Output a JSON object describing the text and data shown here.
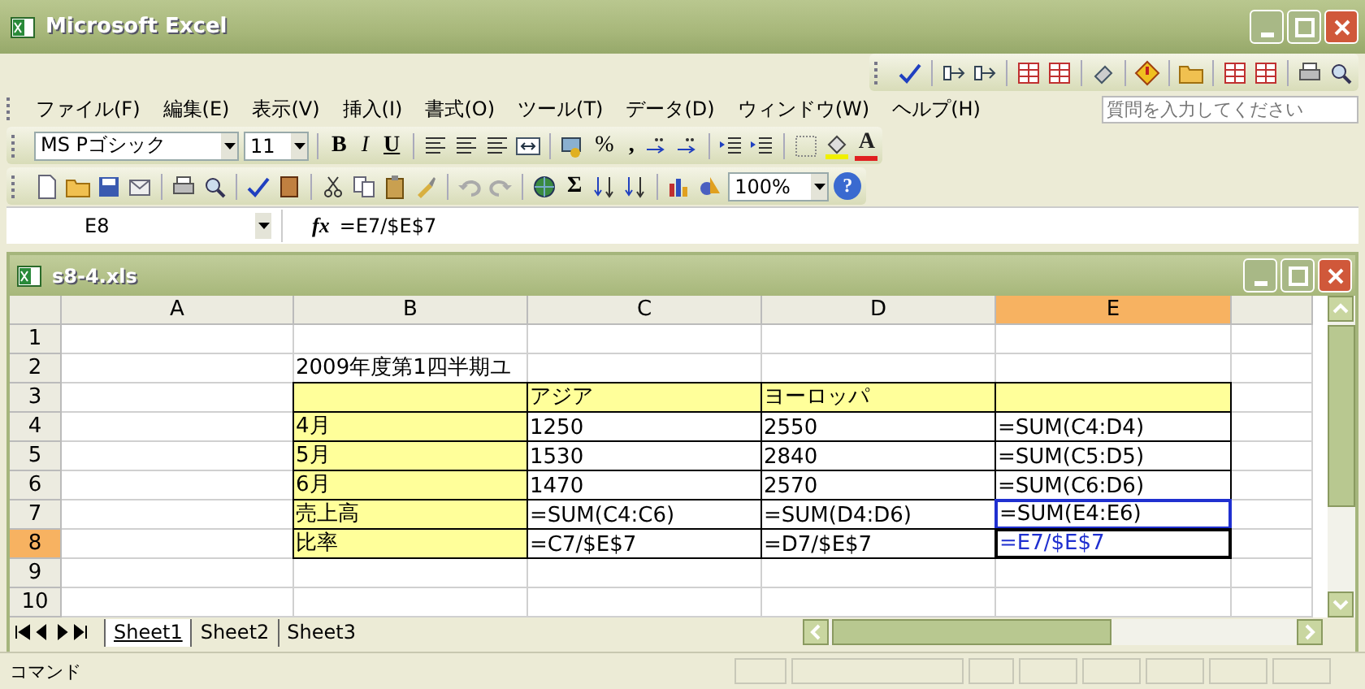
{
  "window": {
    "title": "Microsoft Excel"
  },
  "menu": [
    {
      "label": "ファイル(F)"
    },
    {
      "label": "編集(E)"
    },
    {
      "label": "表示(V)"
    },
    {
      "label": "挿入(I)"
    },
    {
      "label": "書式(O)"
    },
    {
      "label": "ツール(T)"
    },
    {
      "label": "データ(D)"
    },
    {
      "label": "ウィンドウ(W)"
    },
    {
      "label": "ヘルプ(H)"
    }
  ],
  "help_search": {
    "placeholder": "質問を入力してください"
  },
  "format_toolbar": {
    "font": "MS Pゴシック",
    "size": "11",
    "bold": "B",
    "italic": "I",
    "underline": "U",
    "percent": "%",
    "comma": ",",
    "font_color": "A"
  },
  "standard_toolbar": {
    "autosum": "Σ",
    "zoom": "100%",
    "help": "?"
  },
  "formula_bar": {
    "name_box": "E8",
    "function_label": "fx",
    "formula": "=E7/$E$7"
  },
  "workbook": {
    "title": "s8-4.xls",
    "columns": [
      {
        "label": "A",
        "selected": false
      },
      {
        "label": "B",
        "selected": false
      },
      {
        "label": "C",
        "selected": false
      },
      {
        "label": "D",
        "selected": false
      },
      {
        "label": "E",
        "selected": true
      }
    ],
    "rows": [
      {
        "number": "1",
        "selected": false,
        "cells": [
          {
            "kind": "plain"
          },
          {
            "kind": "plain"
          },
          {
            "kind": "plain"
          },
          {
            "kind": "plain"
          },
          {
            "kind": "plain"
          }
        ]
      },
      {
        "number": "2",
        "selected": false,
        "cells": [
          {
            "kind": "plain"
          },
          {
            "kind": "plain",
            "text": "2009年度第1四半期ユ"
          },
          {
            "kind": "plain"
          },
          {
            "kind": "plain"
          },
          {
            "kind": "plain"
          }
        ]
      },
      {
        "number": "3",
        "selected": false,
        "cells": [
          {
            "kind": "plain"
          },
          {
            "kind": "label"
          },
          {
            "kind": "label",
            "text": "アジア"
          },
          {
            "kind": "label",
            "text": "ヨーロッパ"
          },
          {
            "kind": "label"
          }
        ]
      },
      {
        "number": "4",
        "selected": false,
        "cells": [
          {
            "kind": "plain"
          },
          {
            "kind": "label",
            "text": "4月"
          },
          {
            "kind": "data",
            "text": "1250"
          },
          {
            "kind": "data",
            "text": "2550"
          },
          {
            "kind": "data",
            "text": "=SUM(C4:D4)"
          }
        ]
      },
      {
        "number": "5",
        "selected": false,
        "cells": [
          {
            "kind": "plain"
          },
          {
            "kind": "label",
            "text": "5月"
          },
          {
            "kind": "data",
            "text": "1530"
          },
          {
            "kind": "data",
            "text": "2840"
          },
          {
            "kind": "data",
            "text": "=SUM(C5:D5)"
          }
        ]
      },
      {
        "number": "6",
        "selected": false,
        "cells": [
          {
            "kind": "plain"
          },
          {
            "kind": "label",
            "text": "6月"
          },
          {
            "kind": "data",
            "text": "1470"
          },
          {
            "kind": "data",
            "text": "2570"
          },
          {
            "kind": "data",
            "text": "=SUM(C6:D6)"
          }
        ]
      },
      {
        "number": "7",
        "selected": false,
        "cells": [
          {
            "kind": "plain"
          },
          {
            "kind": "label",
            "text": "売上高"
          },
          {
            "kind": "data",
            "text": "=SUM(C4:C6)"
          },
          {
            "kind": "data",
            "text": "=SUM(D4:D6)"
          },
          {
            "kind": "reference",
            "text": "=SUM(E4:E6)"
          }
        ]
      },
      {
        "number": "8",
        "selected": true,
        "cells": [
          {
            "kind": "plain"
          },
          {
            "kind": "label",
            "text": "比率"
          },
          {
            "kind": "data",
            "text": "=C7/$E$7"
          },
          {
            "kind": "data",
            "text": "=D7/$E$7"
          },
          {
            "kind": "editing",
            "text": "=E7/$E$7"
          }
        ]
      },
      {
        "number": "9",
        "selected": false,
        "cells": [
          {
            "kind": "plain"
          },
          {
            "kind": "plain"
          },
          {
            "kind": "plain"
          },
          {
            "kind": "plain"
          },
          {
            "kind": "plain"
          }
        ]
      },
      {
        "number": "10",
        "selected": false,
        "cells": [
          {
            "kind": "plain"
          },
          {
            "kind": "plain"
          },
          {
            "kind": "plain"
          },
          {
            "kind": "plain"
          },
          {
            "kind": "plain"
          }
        ]
      }
    ],
    "sheets": [
      {
        "label": "Sheet1",
        "selected": true
      },
      {
        "label": "Sheet2",
        "selected": false
      },
      {
        "label": "Sheet3",
        "selected": false
      }
    ]
  },
  "status_bar": {
    "mode": "コマンド"
  }
}
